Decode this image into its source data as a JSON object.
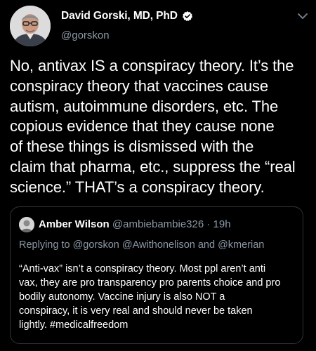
{
  "author": {
    "display_name": "David Gorski, MD, PhD",
    "handle": "@gorskon",
    "verified_icon": "verified-badge-icon",
    "avatar_icon": "profile-photo"
  },
  "tweet": {
    "text": "No, antivax IS a conspiracy theory. It’s the\nconspiracy theory that vaccines cause\nautism, autoimmune disorders, etc. The\ncopious evidence that they cause none\nof these things is dismissed with the\nclaim that pharma, etc., suppress the “real\nscience.” THAT’s a conspiracy theory."
  },
  "quoted_tweet": {
    "display_name": "Amber Wilson",
    "handle_and_time": "@ambiebambie326 · 19h",
    "replying_to": "Replying to @gorskon @Awithonelison and @kmerian",
    "text": "“Anti-vax” isn’t a conspiracy theory. Most ppl aren’t anti\nvax, they are pro transparency pro parents choice and pro\nbodily autonomy. Vaccine injury is also NOT a\nconspiracy, it is very real and should never be taken\nlightly. #medicalfreedom"
  },
  "colors": {
    "background": "#000000",
    "primary_text": "#ffffff",
    "secondary_text": "#8b98a5",
    "border": "#2f3336",
    "verified_badge": "#ffffff"
  },
  "icons": {
    "menu": "chevron-down-icon"
  }
}
